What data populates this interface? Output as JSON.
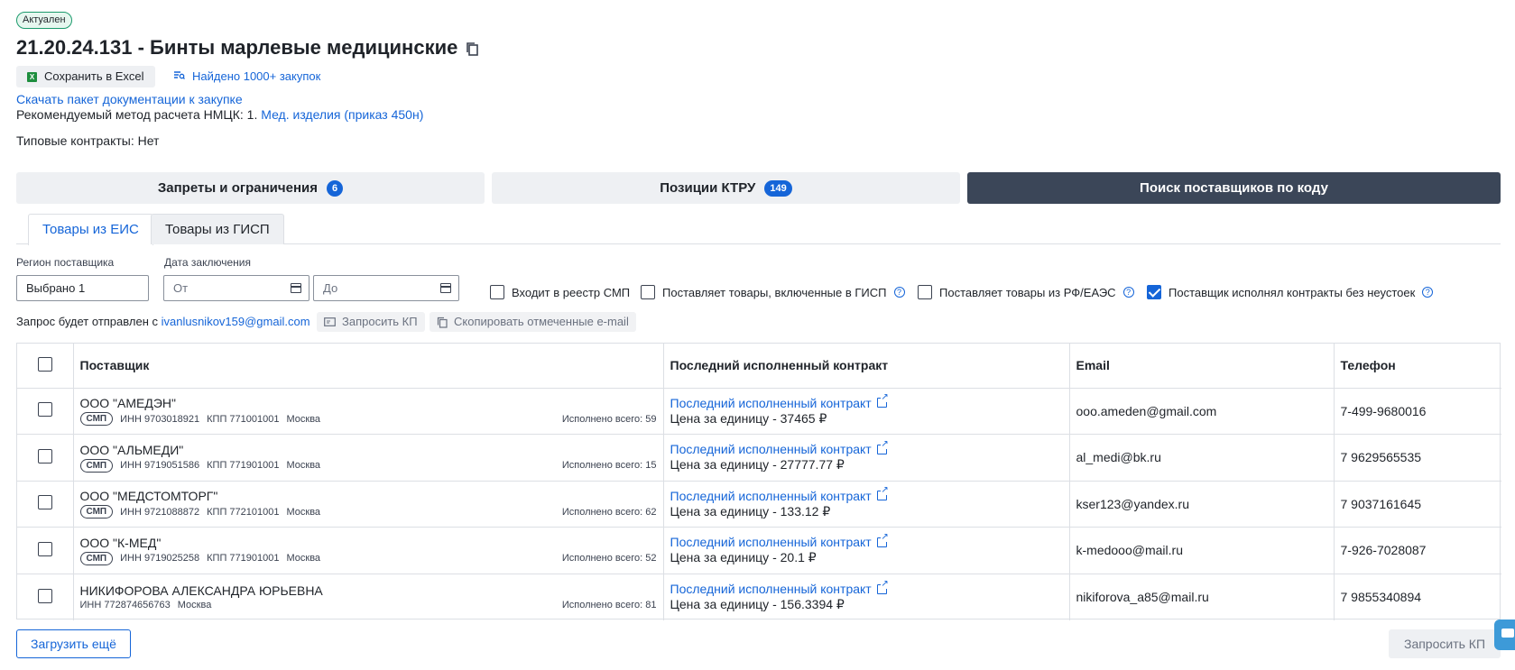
{
  "status_badge": "Актуален",
  "title": "21.20.24.131 - Бинты марлевые медицинские",
  "toolbar": {
    "excel_label": "Сохранить в Excel",
    "found_label": "Найдено 1000+ закупок"
  },
  "docs_link": "Скачать пакет документации к закупке",
  "method": {
    "prefix": "Рекомендуемый метод расчета НМЦК: 1.",
    "link": "Мед. изделия (приказ 450н)"
  },
  "typical_contracts": "Типовые контракты: Нет",
  "big_tabs": [
    {
      "label": "Запреты и ограничения",
      "count": "6"
    },
    {
      "label": "Позиции КТРУ",
      "count": "149"
    },
    {
      "label": "Поиск поставщиков по коду"
    }
  ],
  "sub_tabs": [
    {
      "label": "Товары из ЕИС"
    },
    {
      "label": "Товары из ГИСП"
    }
  ],
  "filters": {
    "region_label": "Регион поставщика",
    "region_value": "Выбрано 1",
    "date_label": "Дата заключения",
    "date_from_placeholder": "От",
    "date_to_placeholder": "До",
    "checkboxes": [
      {
        "label": "Входит в реестр СМП",
        "checked": false
      },
      {
        "label": "Поставляет товары, включенные в ГИСП",
        "checked": false
      },
      {
        "label": "Поставляет товары из РФ/ЕАЭС",
        "checked": false
      },
      {
        "label": "Поставщик исполнял контракты без неустоек",
        "checked": true
      }
    ]
  },
  "request": {
    "prefix": "Запрос будет отправлен с",
    "email": "ivanlusnikov159@gmail.com",
    "request_kp": "Запросить КП",
    "copy_emails": "Скопировать отмеченные e-mail"
  },
  "table": {
    "headers": {
      "supplier": "Поставщик",
      "contract": "Последний исполненный контракт",
      "email": "Email",
      "phone": "Телефон"
    },
    "rows": [
      {
        "name": "ООО \"АМЕДЭН\"",
        "smp": "СМП",
        "inn": "ИНН 9703018921",
        "kpp": "КПП 771001001",
        "city": "Москва",
        "done": "Исполнено всего: 59",
        "contract_link": "Последний исполненный контракт",
        "price": "Цена за единицу - 37465 ₽",
        "email": "ooo.ameden@gmail.com",
        "phone": "7-499-9680016"
      },
      {
        "name": "ООО \"АЛЬМЕДИ\"",
        "smp": "СМП",
        "inn": "ИНН 9719051586",
        "kpp": "КПП 771901001",
        "city": "Москва",
        "done": "Исполнено всего: 15",
        "contract_link": "Последний исполненный контракт",
        "price": "Цена за единицу - 27777.77 ₽",
        "email": "al_medi@bk.ru",
        "phone": "7 9629565535"
      },
      {
        "name": "ООО \"МЕДСТОМТОРГ\"",
        "smp": "СМП",
        "inn": "ИНН 9721088872",
        "kpp": "КПП 772101001",
        "city": "Москва",
        "done": "Исполнено всего: 62",
        "contract_link": "Последний исполненный контракт",
        "price": "Цена за единицу - 133.12 ₽",
        "email": "kser123@yandex.ru",
        "phone": "7 9037161645"
      },
      {
        "name": "ООО \"К-МЕД\"",
        "smp": "СМП",
        "inn": "ИНН 9719025258",
        "kpp": "КПП 771901001",
        "city": "Москва",
        "done": "Исполнено всего: 52",
        "contract_link": "Последний исполненный контракт",
        "price": "Цена за единицу - 20.1 ₽",
        "email": "k-medooo@mail.ru",
        "phone": "7-926-7028087"
      },
      {
        "name": "НИКИФОРОВА АЛЕКСАНДРА ЮРЬЕВНА",
        "smp": "",
        "inn": "ИНН 772874656763",
        "kpp": "",
        "city": "Москва",
        "done": "Исполнено всего: 81",
        "contract_link": "Последний исполненный контракт",
        "price": "Цена за единицу - 156.3394 ₽",
        "email": "nikiforova_a85@mail.ru",
        "phone": "7 9855340894"
      }
    ]
  },
  "bottom": {
    "load_more": "Загрузить ещё",
    "request_kp": "Запросить КП"
  },
  "colors": {
    "accent": "#1565d8",
    "active_tab": "#3b4658",
    "status_green": "#1b9a6c",
    "excel_green": "#1e8e3e"
  }
}
